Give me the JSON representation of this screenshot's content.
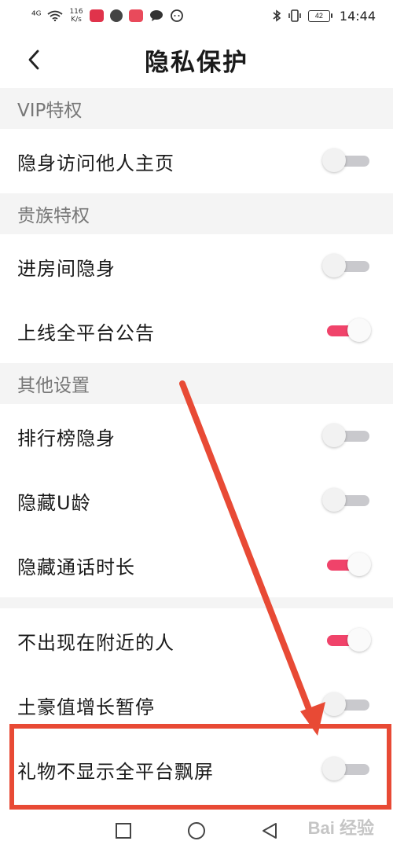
{
  "status_bar": {
    "signal": "⁴ᴳ",
    "speed_top": "116",
    "speed_bottom": "K/s",
    "battery": "42",
    "time": "14:44",
    "icons": [
      "signal-icon",
      "wifi-icon",
      "app-icon-red",
      "app-icon-shield",
      "app-icon-pink",
      "chat-icon",
      "message-icon",
      "bluetooth-icon",
      "vibrate-icon",
      "battery-icon"
    ]
  },
  "header": {
    "title": "隐私保护",
    "back_icon": "chevron-left-icon"
  },
  "sections": [
    {
      "title": "VIP特权",
      "items": [
        {
          "label": "隐身访问他人主页",
          "on": false
        }
      ]
    },
    {
      "title": "贵族特权",
      "items": [
        {
          "label": "进房间隐身",
          "on": false
        },
        {
          "label": "上线全平台公告",
          "on": true
        }
      ]
    },
    {
      "title": "其他设置",
      "items": [
        {
          "label": "排行榜隐身",
          "on": false
        },
        {
          "label": "隐藏U龄",
          "on": false
        },
        {
          "label": "隐藏通话时长",
          "on": true
        }
      ]
    },
    {
      "title": "",
      "items": [
        {
          "label": "不出现在附近的人",
          "on": true
        },
        {
          "label": "土豪值增长暂停",
          "on": false
        },
        {
          "label": "礼物不显示全平台飘屏",
          "on": false
        }
      ]
    }
  ],
  "bottom_nav": {
    "icons": [
      "square-icon",
      "circle-icon",
      "triangle-back-icon"
    ]
  },
  "watermark": "Bai 经验",
  "colors": {
    "toggle_on": "#f0436a",
    "toggle_off": "#c9c9cd",
    "annotation": "#e84a35"
  }
}
